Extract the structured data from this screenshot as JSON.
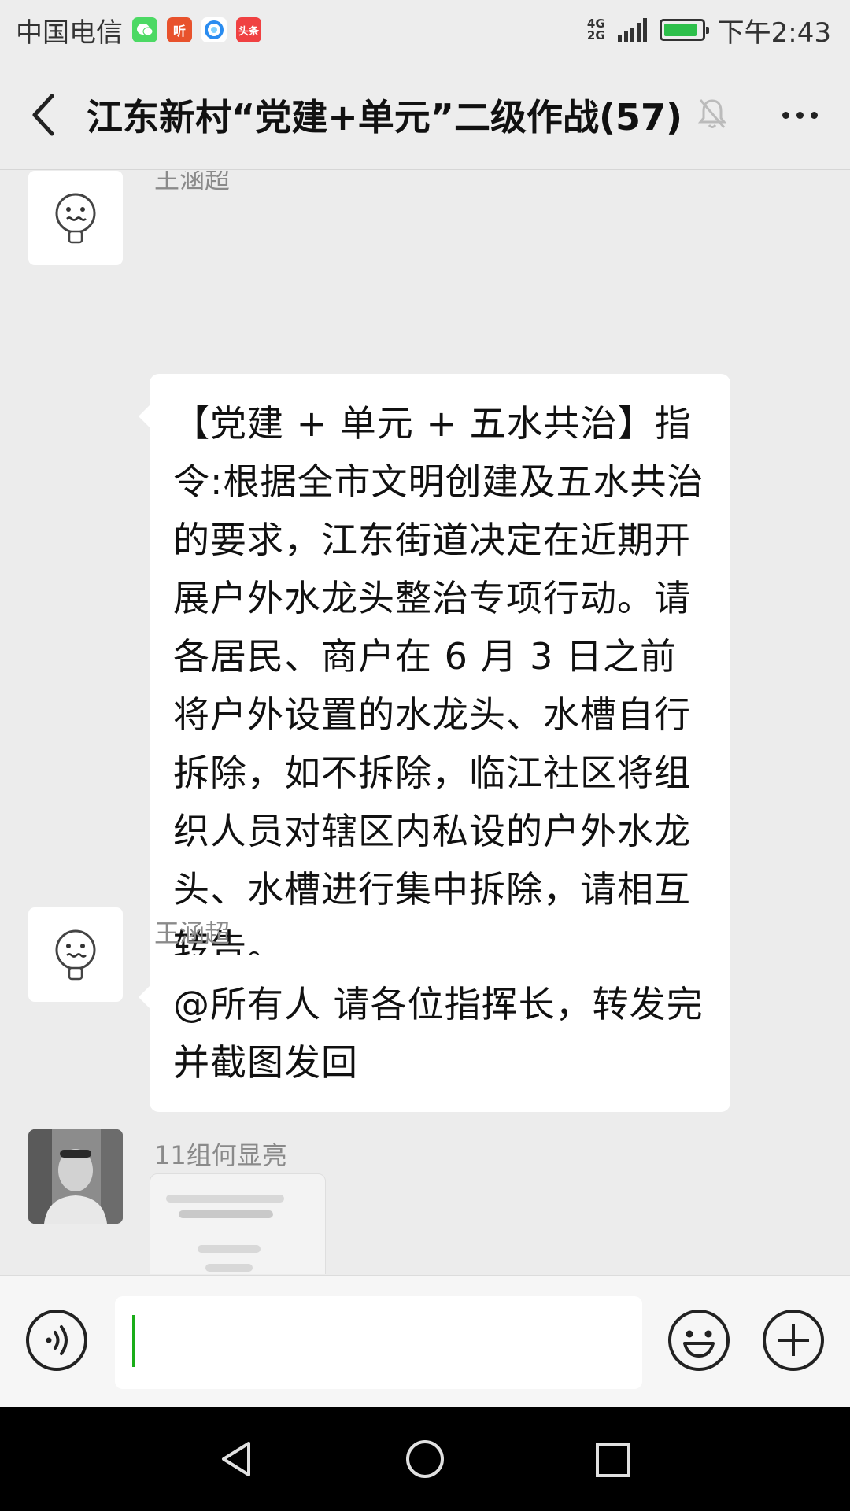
{
  "status_bar": {
    "carrier": "中国电信",
    "apps": [
      {
        "icon": "wechat-app-icon",
        "label": "",
        "color": "#4cd964"
      },
      {
        "icon": "listen-app-icon",
        "label": "听",
        "color": "#e8522c"
      },
      {
        "icon": "browser-app-icon",
        "label": "",
        "color": "#ffffff"
      },
      {
        "icon": "toutiao-app-icon",
        "label": "头条",
        "color": "#f04142"
      }
    ],
    "network_top": "4G",
    "network_bottom": "2G",
    "battery_level": 0.9,
    "battery_color": "#2dbf4a",
    "time": "下午2:43"
  },
  "header": {
    "back_icon": "back-chevron-icon",
    "title": "江东新村“党建+单元”二级作战(57)",
    "mute_icon": "bell-muted-icon",
    "more_icon": "more-dots-icon"
  },
  "messages": [
    {
      "sender": "王涵超",
      "avatar_icon": "cartoon-face-avatar",
      "text": "【党建 + 单元 + 五水共治】指令:根据全市文明创建及五水共治的要求，江东街道决定在近期开展户外水龙头整治专项行动。请各居民、商户在 6 月 3 日之前将户外设置的水龙头、水槽自行拆除，如不拆除，临江社区将组织人员对辖区内私设的户外水龙头、水槽进行集中拆除，请相互转告。"
    },
    {
      "sender": "王涵超",
      "avatar_icon": "cartoon-face-avatar",
      "text": "@所有人   请各位指挥长，转发完并截图发回"
    },
    {
      "sender": "11组何显亮",
      "avatar_icon": "man-photo-avatar",
      "text": ""
    }
  ],
  "input_bar": {
    "voice_icon": "voice-input-icon",
    "text_value": "",
    "emoji_icon": "emoji-icon",
    "plus_icon": "plus-icon",
    "cursor_color": "#1aad19"
  },
  "nav_bar": {
    "back_icon": "nav-back-icon",
    "home_icon": "nav-home-icon",
    "recent_icon": "nav-recent-icon"
  }
}
